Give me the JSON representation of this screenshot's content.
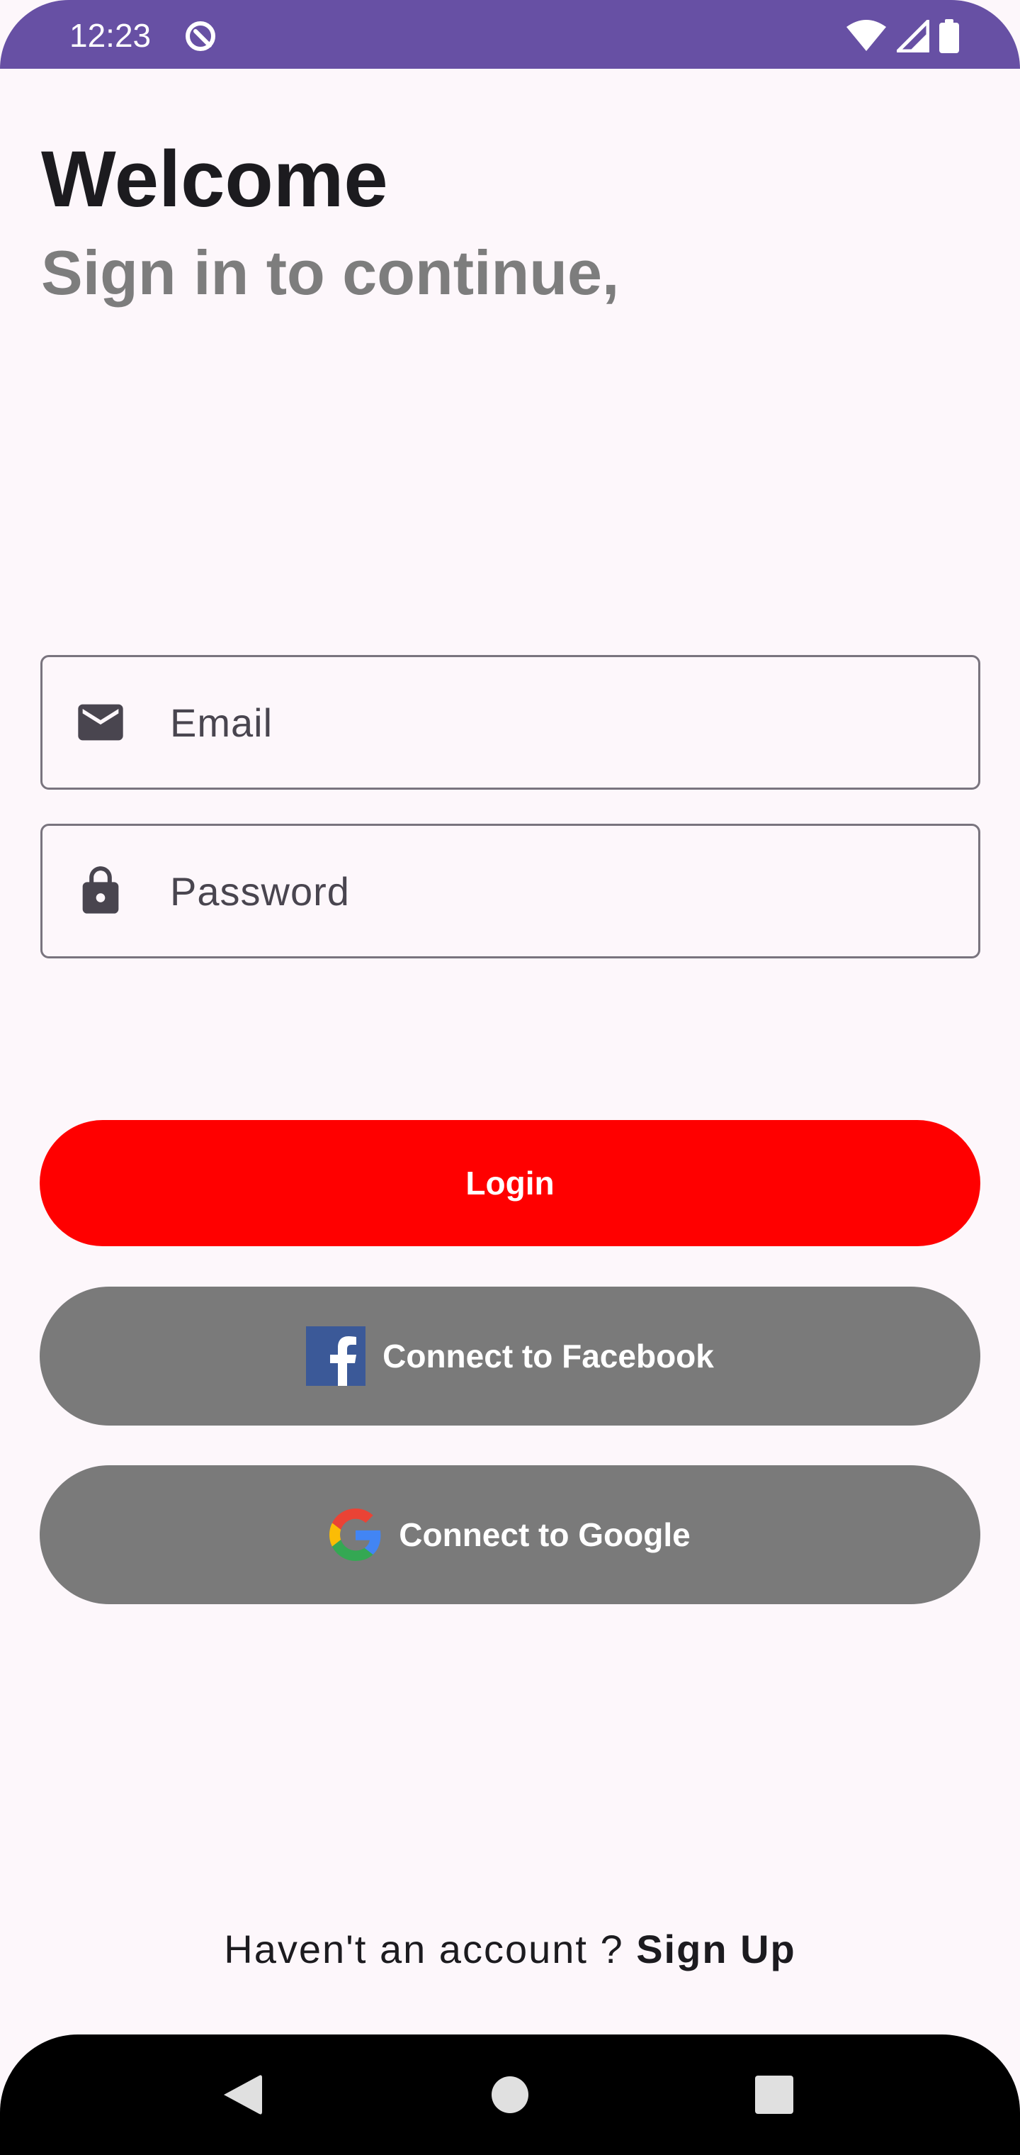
{
  "status_bar": {
    "time": "12:23",
    "app_icon": "app-notification-icon",
    "icons": [
      "wifi-icon",
      "signal-icon",
      "battery-icon"
    ],
    "color": "#6750A4"
  },
  "header": {
    "title": "Welcome",
    "subtitle": "Sign in to continue,"
  },
  "form": {
    "email": {
      "icon": "mail-icon",
      "placeholder": "Email",
      "value": ""
    },
    "password": {
      "icon": "lock-icon",
      "placeholder": "Password",
      "value": ""
    }
  },
  "buttons": {
    "login": {
      "label": "Login",
      "color": "#FF0000"
    },
    "facebook": {
      "label": "Connect to Facebook",
      "icon": "facebook-icon",
      "color": "#7A7A7A"
    },
    "google": {
      "label": "Connect to Google",
      "icon": "google-icon",
      "color": "#7A7A7A"
    }
  },
  "footer": {
    "prompt": "Haven't an account ? ",
    "signup_label": "Sign Up"
  },
  "nav_bar": {
    "buttons": [
      "back-icon",
      "home-icon",
      "recents-icon"
    ]
  }
}
